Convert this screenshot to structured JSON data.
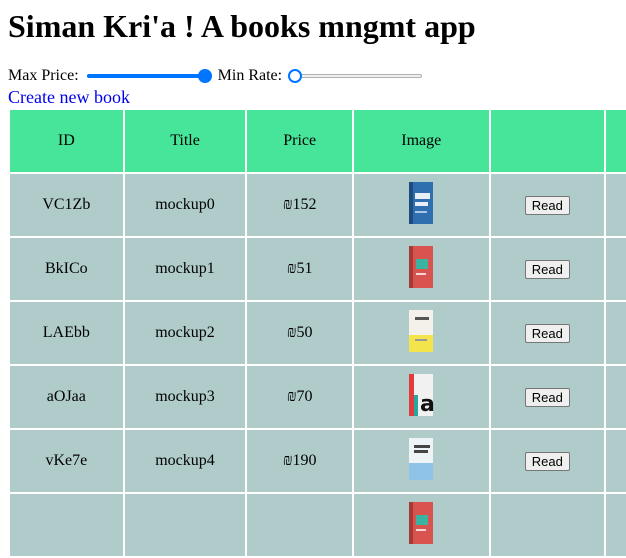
{
  "app": {
    "title": "Siman Kri'a ! A books mngmt app"
  },
  "filters": {
    "max_price_label": "Max Price:",
    "max_price_level": 1.0,
    "min_rate_label": "Min Rate:",
    "min_rate_level": 0.0
  },
  "links": {
    "create_new_book": "Create new book"
  },
  "table": {
    "headers": [
      "ID",
      "Title",
      "Price",
      "Image",
      "",
      ""
    ],
    "rows": [
      {
        "id": "VC1Zb",
        "title": "mockup0",
        "price": "₪152",
        "action": "Read",
        "cover": "blue-book-icon"
      },
      {
        "id": "BkICo",
        "title": "mockup1",
        "price": "₪51",
        "action": "Read",
        "cover": "red-book-icon"
      },
      {
        "id": "LAEbb",
        "title": "mockup2",
        "price": "₪50",
        "action": "Read",
        "cover": "yellow-book-icon"
      },
      {
        "id": "aOJaa",
        "title": "mockup3",
        "price": "₪70",
        "action": "Read",
        "cover": "letter-a-book-icon"
      },
      {
        "id": "vKe7e",
        "title": "mockup4",
        "price": "₪190",
        "action": "Read",
        "cover": "light-blue-book-icon"
      },
      {
        "id": "",
        "title": "",
        "price": "",
        "action": "",
        "cover": "red-book-icon"
      }
    ]
  },
  "colors": {
    "header_bg": "#47e599",
    "row_bg": "#afcccb",
    "link": "#0000ee",
    "slider_accent": "#0075ff"
  }
}
